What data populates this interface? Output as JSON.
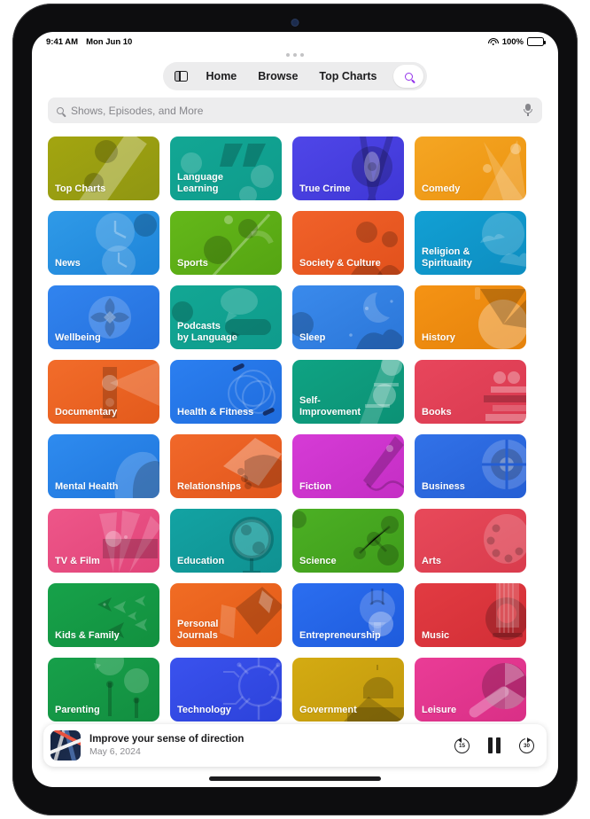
{
  "status_bar": {
    "time": "9:41 AM",
    "date": "Mon Jun 10",
    "battery_percent": "100%",
    "wifi_icon": "wifi-icon",
    "battery_icon": "battery-icon"
  },
  "nav": {
    "sidebar_icon": "sidebar-toggle-icon",
    "items": [
      {
        "label": "Home"
      },
      {
        "label": "Browse"
      },
      {
        "label": "Top Charts"
      }
    ],
    "search_icon": "search-icon",
    "search_icon_color": "#9333ea"
  },
  "search": {
    "placeholder": "Shows, Episodes, and More",
    "value": "",
    "leading_icon": "search-icon",
    "trailing_icon": "microphone-icon"
  },
  "categories": [
    {
      "label": "Top Charts",
      "color": "#a3a510",
      "color2": "#8f9612",
      "art": "diagonal"
    },
    {
      "label": "Language Learning",
      "color": "#12a794",
      "color2": "#0f9b8c",
      "art": "quotes"
    },
    {
      "label": "True Crime",
      "color": "#4f46e8",
      "color2": "#3f37d6",
      "art": "eye"
    },
    {
      "label": "Comedy",
      "color": "#f5a623",
      "color2": "#ec9310",
      "art": "rays"
    },
    {
      "label": "News",
      "color": "#2f9ae8",
      "color2": "#1e84d8",
      "art": "clock"
    },
    {
      "label": "Sports",
      "color": "#64b81a",
      "color2": "#55a412",
      "art": "leaf"
    },
    {
      "label": "Society & Culture",
      "color": "#f1622a",
      "color2": "#e2511c",
      "art": "people"
    },
    {
      "label": "Religion &\nSpirituality",
      "color": "#12a0d4",
      "color2": "#0d8dc0",
      "art": "clouds"
    },
    {
      "label": "Wellbeing",
      "color": "#3184ef",
      "color2": "#2570dc",
      "art": "flower"
    },
    {
      "label": "Podcasts\nby Language",
      "color": "#12a794",
      "color2": "#0f9b8c",
      "art": "bubbles"
    },
    {
      "label": "Sleep",
      "color": "#3a8aec",
      "color2": "#2b76d8",
      "art": "moon"
    },
    {
      "label": "History",
      "color": "#f59314",
      "color2": "#e5820b",
      "art": "fan"
    },
    {
      "label": "Documentary",
      "color": "#f26c2a",
      "color2": "#e35a1c",
      "art": "projector"
    },
    {
      "label": "Health & Fitness",
      "color": "#2b7ff0",
      "color2": "#1f6cdd",
      "art": "rings"
    },
    {
      "label": "Self-Improvement",
      "color": "#0fa383",
      "color2": "#0c9175",
      "art": "ladder"
    },
    {
      "label": "Books",
      "color": "#e8465c",
      "color2": "#d93a50",
      "art": "books"
    },
    {
      "label": "Mental Health",
      "color": "#2e8bef",
      "color2": "#2076dc",
      "art": "heads"
    },
    {
      "label": "Relationships",
      "color": "#f1682a",
      "color2": "#e2571c",
      "art": "hands"
    },
    {
      "label": "Fiction",
      "color": "#d63bd6",
      "color2": "#c42ec4",
      "art": "pen"
    },
    {
      "label": "Business",
      "color": "#3272e8",
      "color2": "#245ed4",
      "art": "target"
    },
    {
      "label": "TV & Film",
      "color": "#ee5689",
      "color2": "#e04479",
      "art": "spotlight"
    },
    {
      "label": "Education",
      "color": "#13a3a3",
      "color2": "#0f9191",
      "art": "globe"
    },
    {
      "label": "Science",
      "color": "#4cb024",
      "color2": "#3f9c1b",
      "art": "molecule"
    },
    {
      "label": "Arts",
      "color": "#e8495a",
      "color2": "#d93c4d",
      "art": "palette"
    },
    {
      "label": "Kids & Family",
      "color": "#17a24a",
      "color2": "#12903f",
      "art": "fish"
    },
    {
      "label": "Personal Journals",
      "color": "#f16c24",
      "color2": "#e25a17",
      "art": "journal"
    },
    {
      "label": "Entrepreneurship",
      "color": "#2b6ef0",
      "color2": "#1e5bdc",
      "art": "bulb"
    },
    {
      "label": "Music",
      "color": "#e23b42",
      "color2": "#d22e36",
      "art": "guitar"
    },
    {
      "label": "Parenting",
      "color": "#17a04a",
      "color2": "#128e40",
      "art": "trees"
    },
    {
      "label": "Technology",
      "color": "#3a52ee",
      "color2": "#2c42da",
      "art": "circuit"
    },
    {
      "label": "Government",
      "color": "#d4ab12",
      "color2": "#c2990d",
      "art": "capitol"
    },
    {
      "label": "Leisure",
      "color": "#ea3c96",
      "color2": "#d92f86",
      "art": "umbrella"
    }
  ],
  "now_playing": {
    "artwork_name": "episode-artwork",
    "title": "Improve your sense of direction",
    "date": "May 6, 2024",
    "skip_back_label": "15",
    "skip_forward_label": "30",
    "skip_back_icon": "skip-back-15-icon",
    "pause_icon": "pause-icon",
    "skip_forward_icon": "skip-forward-30-icon"
  }
}
